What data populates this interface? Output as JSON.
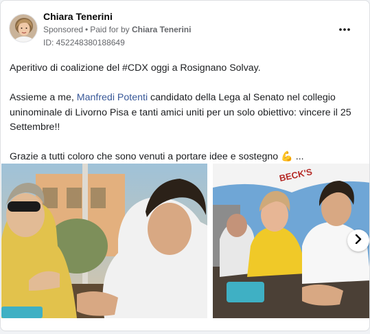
{
  "post": {
    "author": "Chiara Tenerini",
    "sponsored": "Sponsored",
    "separator": "•",
    "paid_for_prefix": "Paid for by",
    "paid_for_name": "Chiara Tenerini",
    "ad_id": "ID: 452248380188649",
    "more_icon": "more-horizontal-icon",
    "text": {
      "line1": "Aperitivo di coalizione del #CDX oggi a Rosignano Solvay.",
      "p2_before": "Assieme a me, ",
      "p2_mention": "Manfredi Potenti",
      "p2_after": " candidato della Lega al Senato nel collegio uninominale di Livorno Pisa e tanti amici uniti per un solo obiettivo: vincere il 25 Settembre!!",
      "p3": "Grazie a tutti coloro che sono venuti a portare idee e sostegno",
      "p3_emoji": "💪",
      "p3_ellipsis": " ..."
    }
  },
  "gallery": {
    "umbrella_text": "BECK'S",
    "next_icon": "chevron-right-icon"
  },
  "colors": {
    "link": "#385898",
    "secondary_text": "#65676b"
  }
}
